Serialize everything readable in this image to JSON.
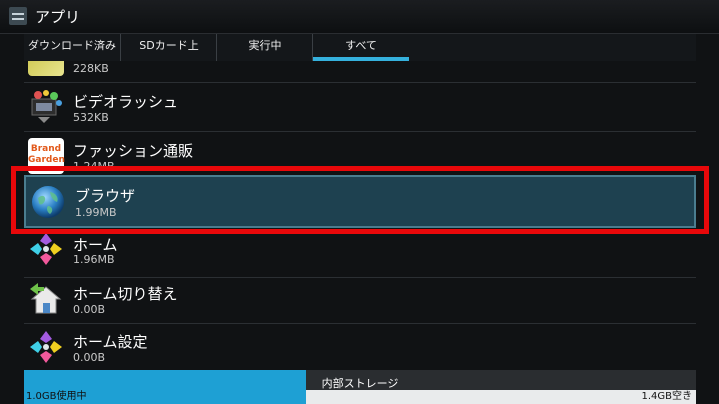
{
  "actionbar": {
    "title": "アプリ"
  },
  "tabs": [
    {
      "label": "ダウンロード済み"
    },
    {
      "label": "SDカード上"
    },
    {
      "label": "実行中"
    },
    {
      "label": "すべて"
    }
  ],
  "apps": [
    {
      "name": "",
      "size": "228KB",
      "icon": "partial-app-icon"
    },
    {
      "name": "ビデオラッシュ",
      "size": "532KB",
      "icon": "video-app-icon"
    },
    {
      "name": "ファッション通販",
      "size": "1.24MB",
      "icon": "brand-garden-icon",
      "icon_text": [
        "Brand",
        "Garden"
      ]
    },
    {
      "name": "ブラウザ",
      "size": "1.99MB",
      "icon": "globe-icon"
    },
    {
      "name": "ホーム",
      "size": "1.96MB",
      "icon": "home-launcher-icon"
    },
    {
      "name": "ホーム切り替え",
      "size": "0.00B",
      "icon": "home-switch-icon"
    },
    {
      "name": "ホーム設定",
      "size": "0.00B",
      "icon": "home-settings-icon"
    }
  ],
  "storage": {
    "label": "内部ストレージ",
    "used": "1.0GB使用中",
    "free": "1.4GB空き",
    "used_fraction": 0.42
  },
  "colors": {
    "accent": "#35b1dd",
    "selection": "#1e4150",
    "highlight": "#e8080a",
    "storage_fill": "#1ea0d4"
  }
}
